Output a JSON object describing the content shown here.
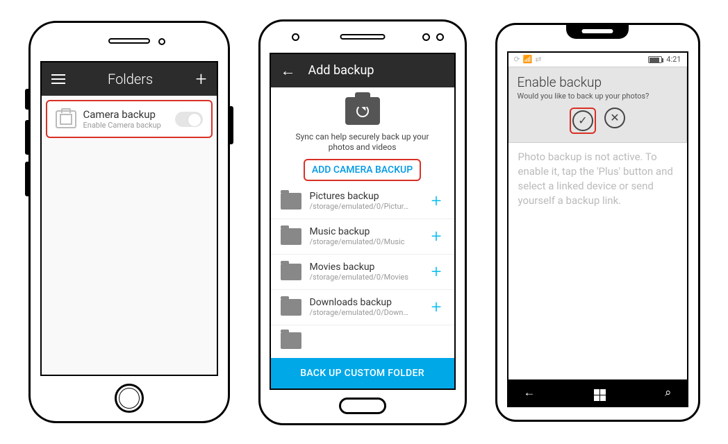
{
  "ios": {
    "header_title": "Folders",
    "row_title": "Camera backup",
    "row_subtitle": "Enable Camera backup"
  },
  "android": {
    "header_title": "Add backup",
    "hero_text": "Sync can help securely back up your photos and videos",
    "add_camera_label": "ADD CAMERA BACKUP",
    "folders": [
      {
        "title": "Pictures backup",
        "path": "/storage/emulated/0/Pictur…"
      },
      {
        "title": "Music backup",
        "path": "/storage/emulated/0/Music"
      },
      {
        "title": "Movies backup",
        "path": "/storage/emulated/0/Movies"
      },
      {
        "title": "Downloads backup",
        "path": "/storage/emulated/0/Down…"
      }
    ],
    "footer_label": "BACK UP CUSTOM FOLDER"
  },
  "wp": {
    "status_time": "4:21",
    "dialog_title": "Enable backup",
    "dialog_subtitle": "Would you like to back up your photos?",
    "body_text": "Photo backup is not active. To enable it, tap the 'Plus' button and select a linked device or send yourself a backup link."
  }
}
